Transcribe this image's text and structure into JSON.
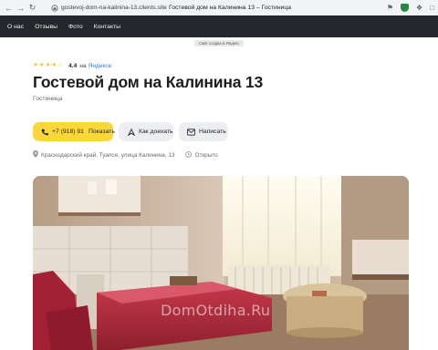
{
  "browser": {
    "url": "gostevoj-dom-na-kalinina-13.clients.site",
    "tab_title": "Гостевой дом на Калинина 13 – Гостиница"
  },
  "nav": {
    "items": [
      "О нас",
      "Отзывы",
      "Фото",
      "Контакты"
    ]
  },
  "created_note": "Сайт создан в Яндекс",
  "rating": {
    "score": "4.4",
    "on": "на",
    "source": "Яндексе",
    "stars": 4.4
  },
  "header": {
    "title": "Гостевой дом на Калинина 13",
    "category": "Гостиница"
  },
  "actions": {
    "phone_number": "+7 (918) 91",
    "show_label": "Показать",
    "route_label": "Как доехать",
    "write_label": "Написать"
  },
  "info": {
    "address": "Краснодарский край, Туапсе, улица Калинина, 13",
    "status": "Открыто"
  },
  "photo": {
    "watermark": "DomOtdiha.Ru"
  },
  "colors": {
    "nav_bg": "#24272b",
    "accent_yellow": "#fcd73a",
    "star": "#fcc419",
    "link_blue": "#3a7bd5"
  }
}
